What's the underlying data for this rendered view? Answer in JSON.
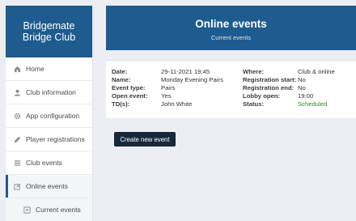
{
  "sidebar": {
    "brand_line1": "Bridgemate",
    "brand_line2": "Bridge Club",
    "items": [
      {
        "label": "Home",
        "icon": "home-icon"
      },
      {
        "label": "Club information",
        "icon": "user-icon"
      },
      {
        "label": "App configuration",
        "icon": "gear-icon"
      },
      {
        "label": "Player registrations",
        "icon": "pencil-icon"
      },
      {
        "label": "Club events",
        "icon": "list-icon"
      },
      {
        "label": "Online events",
        "icon": "edit-icon"
      },
      {
        "label": "Current events",
        "icon": "play-icon"
      }
    ]
  },
  "header": {
    "title": "Online events",
    "subtitle": "Current events"
  },
  "event": {
    "left": [
      {
        "label": "Date:",
        "value": "29-11-2021 19:45"
      },
      {
        "label": "Name:",
        "value": "Monday Evening Pairs"
      },
      {
        "label": "Event type:",
        "value": "Pairs"
      },
      {
        "label": "Open event:",
        "value": "Yes"
      },
      {
        "label": "TD(s):",
        "value": "John White"
      }
    ],
    "right": [
      {
        "label": "Where:",
        "value": "Club & online"
      },
      {
        "label": "Registration start:",
        "value": "No"
      },
      {
        "label": "Registration end:",
        "value": "No"
      },
      {
        "label": "Lobby open:",
        "value": "19:00"
      },
      {
        "label": "Status:",
        "value": "Scheduled"
      }
    ]
  },
  "actions": {
    "create_label": "Create new event"
  },
  "colors": {
    "brand": "#1e5b8e",
    "button": "#16283a",
    "status_scheduled": "#2e8b2e"
  }
}
